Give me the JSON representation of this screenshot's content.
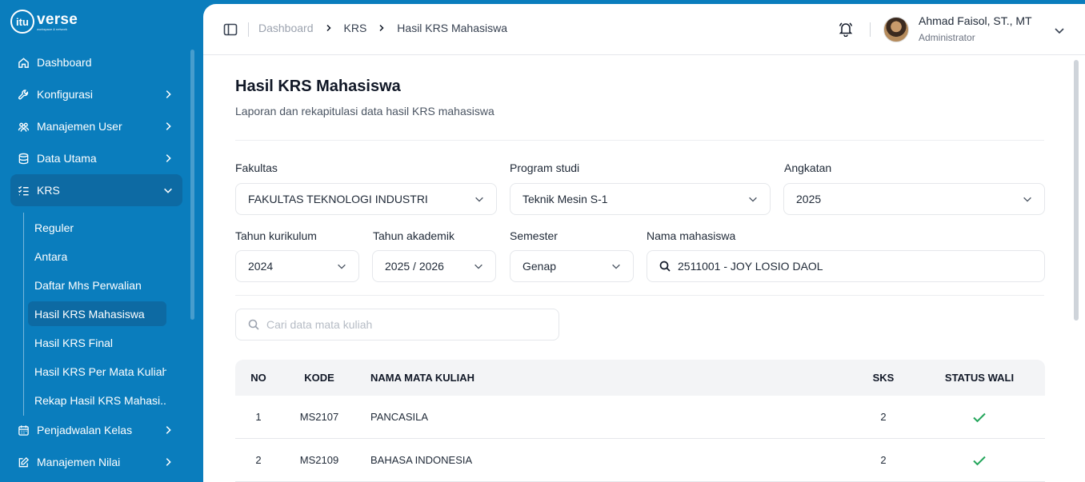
{
  "brand": {
    "name": "verse",
    "mark": "itu",
    "tagline": "workspace & network"
  },
  "sidebar": {
    "items": [
      {
        "label": "Dashboard",
        "icon": "home-icon"
      },
      {
        "label": "Konfigurasi",
        "icon": "wrench-icon"
      },
      {
        "label": "Manajemen User",
        "icon": "users-icon"
      },
      {
        "label": "Data Utama",
        "icon": "database-icon"
      },
      {
        "label": "KRS",
        "icon": "list-checks-icon",
        "expanded": true
      },
      {
        "label": "Penjadwalan Kelas",
        "icon": "calendar-icon"
      },
      {
        "label": "Manajemen Nilai",
        "icon": "edit-icon"
      }
    ],
    "krs_sub": [
      "Reguler",
      "Antara",
      "Daftar Mhs Perwalian",
      "Hasil KRS Mahasiswa",
      "Hasil KRS Final",
      "Hasil KRS Per Mata Kuliah",
      "Rekap Hasil KRS Mahasi..."
    ],
    "active_sub": "Hasil KRS Mahasiswa"
  },
  "header": {
    "breadcrumb": [
      "Dashboard",
      "KRS",
      "Hasil KRS Mahasiswa"
    ],
    "user": {
      "name": "Ahmad Faisol, ST., MT",
      "role": "Administrator"
    }
  },
  "page": {
    "title": "Hasil KRS Mahasiswa",
    "subtitle": "Laporan dan rekapitulasi data hasil KRS mahasiswa"
  },
  "filters": {
    "fakultas": {
      "label": "Fakultas",
      "value": "FAKULTAS TEKNOLOGI INDUSTRI"
    },
    "prodi": {
      "label": "Program studi",
      "value": "Teknik Mesin S-1"
    },
    "angkatan": {
      "label": "Angkatan",
      "value": "2025"
    },
    "kurikulum": {
      "label": "Tahun kurikulum",
      "value": "2024"
    },
    "akademik": {
      "label": "Tahun akademik",
      "value": "2025 / 2026"
    },
    "semester": {
      "label": "Semester",
      "value": "Genap"
    },
    "mahasiswa": {
      "label": "Nama mahasiswa",
      "value": "2511001 - JOY LOSIO DAOL"
    }
  },
  "search": {
    "placeholder": "Cari data mata kuliah",
    "value": ""
  },
  "table": {
    "headers": {
      "no": "NO",
      "kode": "KODE",
      "nama": "NAMA MATA KULIAH",
      "sks": "SKS",
      "wali": "STATUS WALI"
    },
    "rows": [
      {
        "no": "1",
        "kode": "MS2107",
        "nama": "PANCASILA",
        "sks": "2",
        "status_wali": "approved"
      },
      {
        "no": "2",
        "kode": "MS2109",
        "nama": "BAHASA INDONESIA",
        "sks": "2",
        "status_wali": "approved"
      }
    ]
  },
  "colors": {
    "sidebar": "#0a7dbd",
    "active": "#0d6aa3",
    "check": "#22a55a"
  }
}
